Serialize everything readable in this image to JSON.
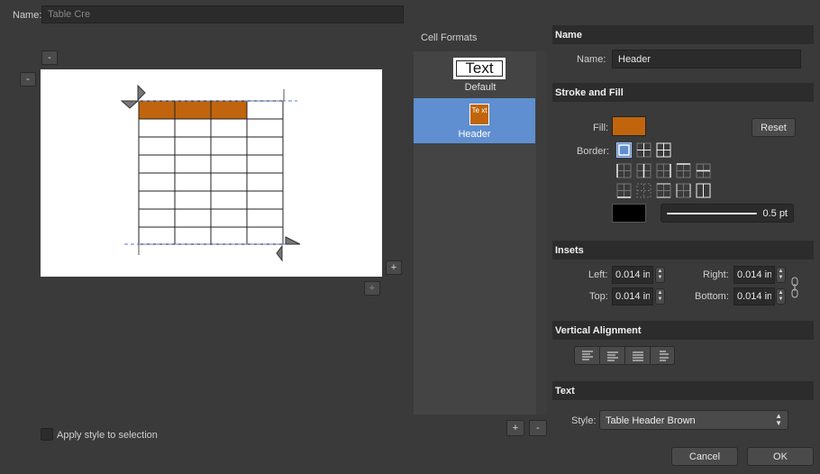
{
  "name_row": {
    "label": "Name:",
    "value": "Table Cre"
  },
  "cell_formats": {
    "title": "Cell Formats",
    "items": [
      {
        "preview": "Text",
        "label": "Default",
        "selected": false
      },
      {
        "preview": "Te xt",
        "label": "Header",
        "selected": true
      }
    ],
    "add": "+",
    "remove": "-"
  },
  "preview_controls": {
    "col_minus": "-",
    "row_minus": "-",
    "col_plus": "+",
    "row_plus": "+"
  },
  "apply_style_label": "Apply style to selection",
  "right_panel": {
    "name_section": {
      "header": "Name",
      "label": "Name:",
      "value": "Header"
    },
    "stroke_fill": {
      "header": "Stroke and Fill",
      "fill_label": "Fill:",
      "fill_color": "#c0650d",
      "reset": "Reset",
      "border_label": "Border:",
      "stroke_color": "#000000",
      "stroke_width": "0.5 pt"
    },
    "insets": {
      "header": "Insets",
      "left_label": "Left:",
      "left_value": "0.014 in",
      "right_label": "Right:",
      "right_value": "0.014 in",
      "top_label": "Top:",
      "top_value": "0.014 in",
      "bottom_label": "Bottom:",
      "bottom_value": "0.014 in"
    },
    "vertical_alignment": {
      "header": "Vertical Alignment"
    },
    "text": {
      "header": "Text",
      "style_label": "Style:",
      "style_value": "Table Header Brown"
    }
  },
  "footer": {
    "cancel": "Cancel",
    "ok": "OK"
  },
  "colors": {
    "header_brown": "#c0650d",
    "selected_blue": "#5f8fd0",
    "bg": "#3a3a3a"
  }
}
